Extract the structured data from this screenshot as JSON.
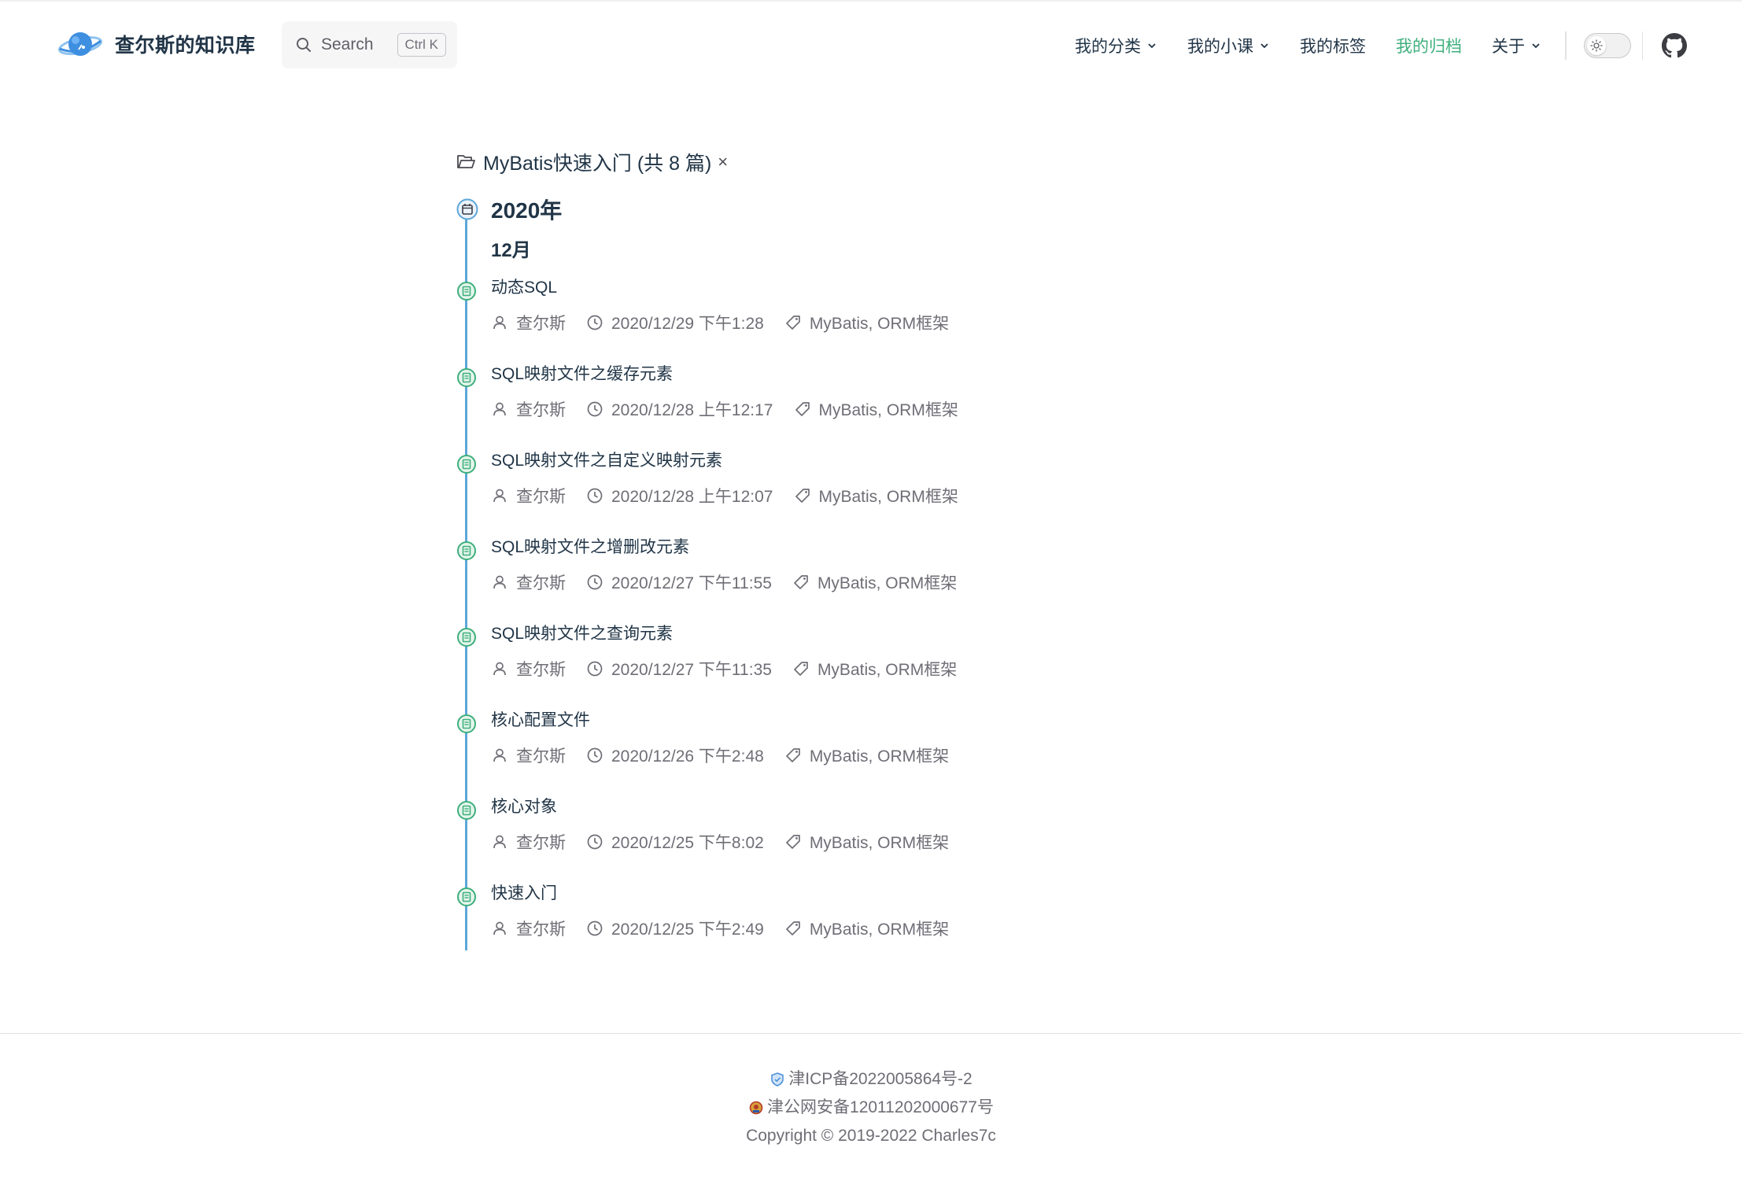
{
  "site": {
    "title": "查尔斯的知识库",
    "logo_icon": "planet-logo-icon"
  },
  "search": {
    "label": "Search",
    "shortcut": "Ctrl K"
  },
  "nav": {
    "items": [
      {
        "label": "我的分类",
        "dropdown": true
      },
      {
        "label": "我的小课",
        "dropdown": true
      },
      {
        "label": "我的标签",
        "dropdown": false
      },
      {
        "label": "我的归档",
        "dropdown": false,
        "active": true
      },
      {
        "label": "关于",
        "dropdown": true
      }
    ],
    "theme_toggle_icon": "sun-icon",
    "github_icon": "github-icon"
  },
  "archive": {
    "category_label": "MyBatis快速入门 (共 8 篇)",
    "close_label": "×",
    "year": "2020年",
    "month": "12月",
    "posts": [
      {
        "title": "动态SQL",
        "author": "查尔斯",
        "date": "2020/12/29 下午1:28",
        "tags": "MyBatis, ORM框架"
      },
      {
        "title": "SQL映射文件之缓存元素",
        "author": "查尔斯",
        "date": "2020/12/28 上午12:17",
        "tags": "MyBatis, ORM框架"
      },
      {
        "title": "SQL映射文件之自定义映射元素",
        "author": "查尔斯",
        "date": "2020/12/28 上午12:07",
        "tags": "MyBatis, ORM框架"
      },
      {
        "title": "SQL映射文件之增删改元素",
        "author": "查尔斯",
        "date": "2020/12/27 下午11:55",
        "tags": "MyBatis, ORM框架"
      },
      {
        "title": "SQL映射文件之查询元素",
        "author": "查尔斯",
        "date": "2020/12/27 下午11:35",
        "tags": "MyBatis, ORM框架"
      },
      {
        "title": "核心配置文件",
        "author": "查尔斯",
        "date": "2020/12/26 下午2:48",
        "tags": "MyBatis, ORM框架"
      },
      {
        "title": "核心对象",
        "author": "查尔斯",
        "date": "2020/12/25 下午8:02",
        "tags": "MyBatis, ORM框架"
      },
      {
        "title": "快速入门",
        "author": "查尔斯",
        "date": "2020/12/25 下午2:49",
        "tags": "MyBatis, ORM框架"
      }
    ]
  },
  "footer": {
    "icp": "津ICP备2022005864号-2",
    "police": "津公网安备12011202000677号",
    "copyright": "Copyright © 2019-2022 Charles7c"
  },
  "colors": {
    "accent": "#3eaf7c",
    "timeline": "#5da7d9",
    "text": "#213547",
    "meta": "#6e6e76"
  }
}
